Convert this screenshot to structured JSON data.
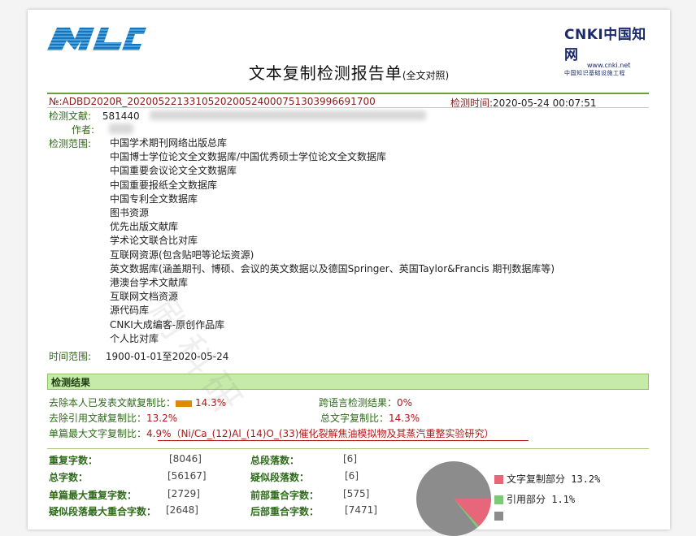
{
  "header": {
    "title": "文本复制检测报告单",
    "title_suffix": "(全文对照)",
    "left_logo_text": "AMLC",
    "right_logo": {
      "brand": "CNKI中国知网",
      "url": "www.cnki.net",
      "subtitle": "中国知识基础设施工程"
    }
  },
  "report": {
    "id_label": "№:",
    "id_value": "ADBD2020R_20200522133105202005240007513039966917​00",
    "time_label": "检测时间:",
    "time_value": "2020-05-24 00:07:51"
  },
  "doc": {
    "doc_label": "检测文献:",
    "doc_value": "581440",
    "author_label": "作者:",
    "scope_label": "检测范围:",
    "scope_items": [
      "中国学术期刊网络出版总库",
      "中国博士学位论文全文数据库/中国优秀硕士学位论文全文数据库",
      "中国重要会议论文全文数据库",
      "中国重要报纸全文数据库",
      "中国专利全文数据库",
      "图书资源",
      "优先出版文献库",
      "学术论文联合比对库",
      "互联网资源(包含贴吧等论坛资源)",
      "英文数据库(涵盖期刊、博硕、会议的英文数据以及德国Springer、英国Taylor&Francis 期刊数据库等)",
      "港澳台学术文献库",
      "互联网文档资源",
      "源代码库",
      "CNKI大成编客-原创作品库",
      "个人比对库"
    ],
    "time_range_label": "时间范围:",
    "time_range_value": "1900-01-01至2020-05-24"
  },
  "results": {
    "section_title": "检测结果",
    "r1_label": "去除本人已发表文献复制比：",
    "r1_value": "14.3%",
    "r1_bar_fraction": 0.143,
    "r2_label": "跨语言检测结果：",
    "r2_value": "0%",
    "r3_label": "去除引用文献复制比：",
    "r3_value": "13.2%",
    "r4_label": "总文字复制比：",
    "r4_value": "14.3%",
    "r5_label": "单篇最大文字复制比：",
    "r5_value": "4.9%（Ni/Ca_(12)Al_(14)O_(33)催化裂解焦油模拟物及其蒸汽重整实验研究）"
  },
  "stats": {
    "dup_chars_label": "重复字数：",
    "dup_chars_value": "[8046]",
    "total_paras_label": "总段落数：",
    "total_paras_value": "[6]",
    "total_chars_label": "总字数：",
    "total_chars_value": "[56167]",
    "suspect_paras_label": "疑似段落数：",
    "suspect_paras_value": "[6]",
    "max_dup_label": "单篇最大重复字数：",
    "max_dup_value": "[2729]",
    "front_overlap_label": "前部重合字数：",
    "front_overlap_value": "[575]",
    "suspect_max_label": "疑似段落最大重合字数：",
    "suspect_max_value": "[2648]",
    "back_overlap_label": "后部重合字数：",
    "back_overlap_value": "[7471]"
  },
  "legend": {
    "copy_label": "文字复制部分 13.2%",
    "cite_label": "引用部分 1.1%",
    "copy_color": "#e8667a",
    "cite_color": "#7dc97a",
    "other_color": "#8c8c8c"
  },
  "pie_data": {
    "copy_fraction": 0.132,
    "cite_fraction": 0.011
  },
  "watermark": "刷科研"
}
